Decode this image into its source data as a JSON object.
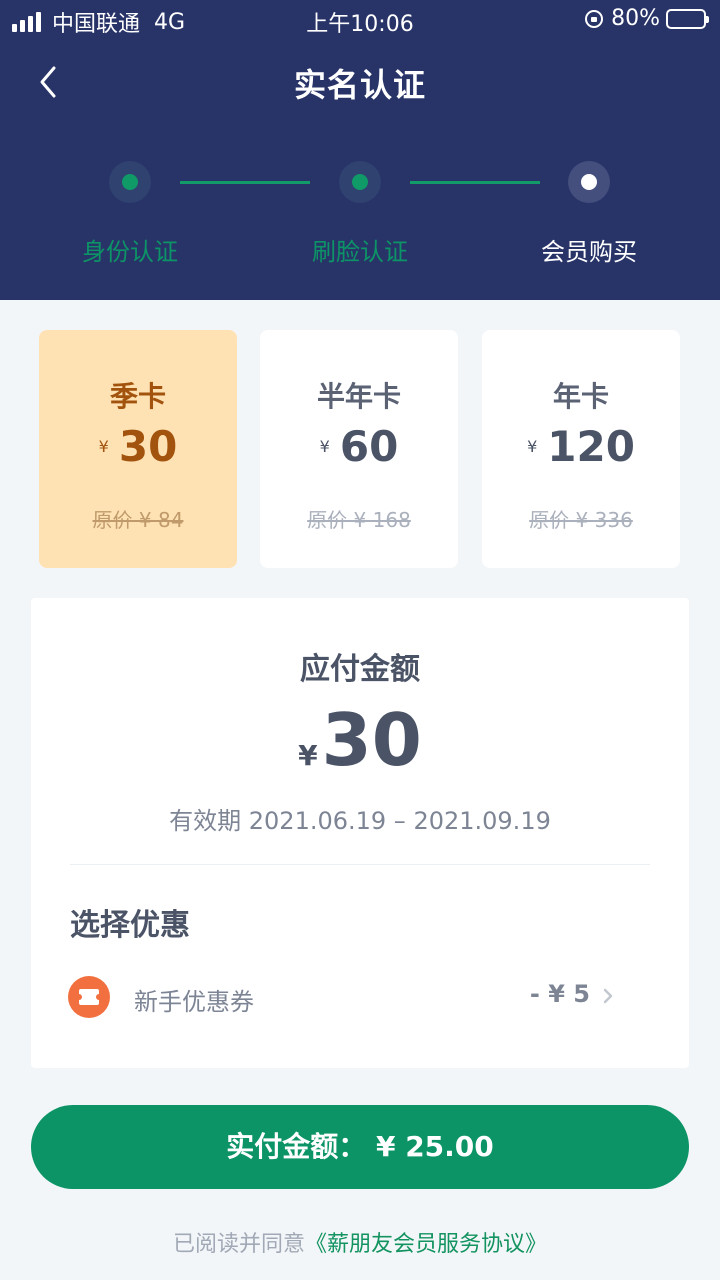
{
  "status_bar": {
    "carrier": "中国联通",
    "network": "4G",
    "time": "上午10:06",
    "battery": "80%",
    "battery_level": 0.8
  },
  "nav": {
    "title": "实名认证",
    "back_icon": "chevron-left-icon"
  },
  "steps": [
    {
      "label": "身份认证",
      "state": "done"
    },
    {
      "label": "刷脸认证",
      "state": "done"
    },
    {
      "label": "会员购买",
      "state": "current"
    }
  ],
  "plans": [
    {
      "name": "季卡",
      "currency": "¥",
      "price": "30",
      "original": "原价 ¥ 84",
      "selected": true
    },
    {
      "name": "半年卡",
      "currency": "¥",
      "price": "60",
      "original": "原价 ¥ 168",
      "selected": false
    },
    {
      "name": "年卡",
      "currency": "¥",
      "price": "120",
      "original": "原价 ¥ 336",
      "selected": false
    }
  ],
  "payment": {
    "title": "应付金额",
    "currency": "¥",
    "amount": "30",
    "validity": "有效期 2021.06.19 – 2021.09.19"
  },
  "discount": {
    "heading": "选择优惠",
    "coupon_label": "新手优惠券",
    "coupon_value": "- ¥ 5",
    "coupon_icon": "ticket-icon"
  },
  "pay_button": {
    "label": "实付金额：  ¥ 25.00"
  },
  "agreement": {
    "prefix": "已阅读并同意",
    "link": "《薪朋友会员服务协议》"
  },
  "colors": {
    "header": "#283468",
    "accent": "#0c9466",
    "selected_card": "#ffe2b4",
    "selected_text": "#a2530d",
    "coupon_icon": "#f2703f"
  }
}
